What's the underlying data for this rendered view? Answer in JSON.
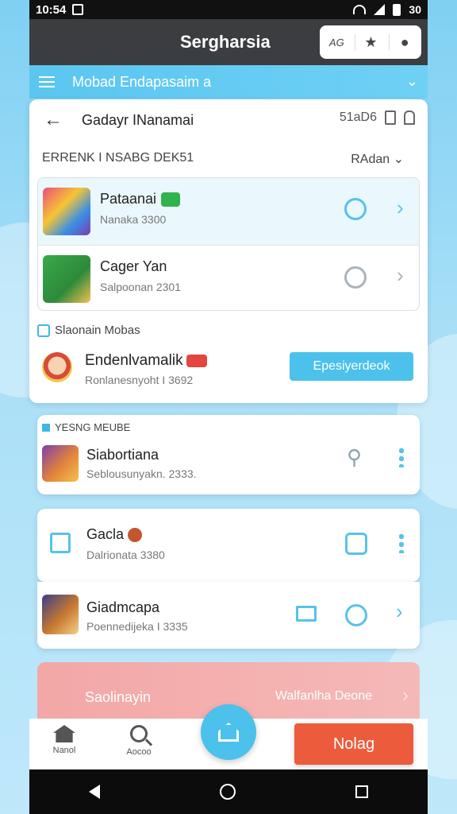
{
  "status_bar": {
    "time": "10:54",
    "battery": "30"
  },
  "app_bar": {
    "title": "Sergharsia",
    "action_label": "AG"
  },
  "sub_bar": {
    "label": "Mobad Endapasaim a"
  },
  "header": {
    "title": "Gadayr INanamai",
    "right_text": "51aD6"
  },
  "section": {
    "title": "ERRENK I NSABG DEK51",
    "sort_label": "RAdan"
  },
  "list": [
    {
      "name": "Pataanai",
      "subtitle": "Nanaka 3300",
      "icon": "game-icon-colorful",
      "badge": "green"
    },
    {
      "name": "Cager Yan",
      "subtitle": "Salpoonan 2301",
      "icon": "game-icon-green"
    }
  ],
  "recommended": {
    "label": "Slaonain Mobas",
    "name": "Endenlvamalik",
    "subtitle": "Ronlanesnyoht I 3692",
    "button_label": "Epesiyerdeok"
  },
  "group": {
    "label": "YESNG MEUBE"
  },
  "items": [
    {
      "name": "Siabortiana",
      "subtitle": "Seblousunyakn. 2333."
    },
    {
      "name": "Gacla",
      "subtitle": "Dalrionata 3380"
    },
    {
      "name": "Giadmcapa",
      "subtitle": "Poennedijeka I 3335"
    }
  ],
  "promo": {
    "title": "Saolinayin",
    "right_text": "Walfanlha Deone"
  },
  "bottom_nav": {
    "home_label": "Nanol",
    "search_label": "Aocoo",
    "cta_label": "Nolag"
  },
  "colors": {
    "accent": "#4bc1ec",
    "cta": "#ec5b3c",
    "appbar": "#3b3d40"
  }
}
